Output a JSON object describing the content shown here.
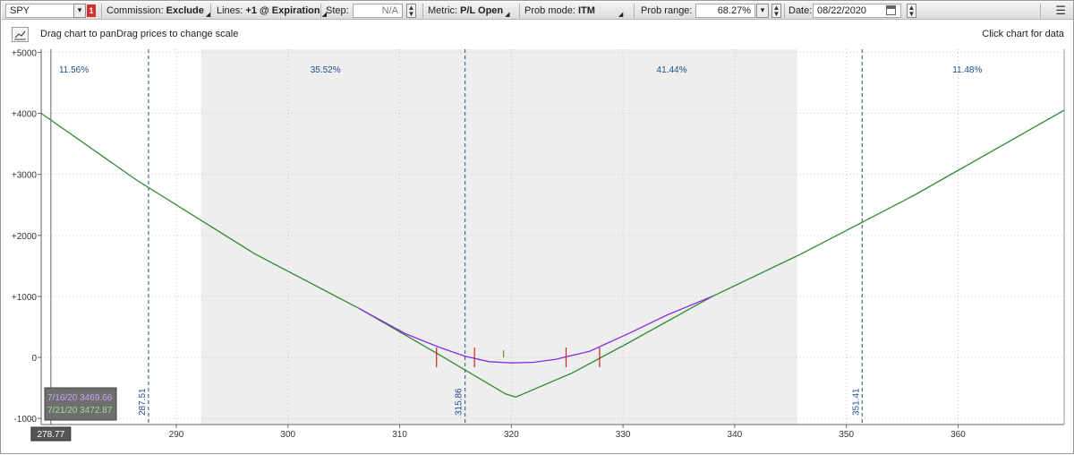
{
  "toolbar": {
    "symbol": "SPY",
    "badge": "1",
    "commission_label": "Commission:",
    "commission_value": "Exclude",
    "lines_label": "Lines:",
    "lines_value": "+1 @ Expiration",
    "step_label": "Step:",
    "step_value": "N/A",
    "metric_label": "Metric:",
    "metric_value": "P/L Open",
    "probmode_label": "Prob mode:",
    "probmode_value": "ITM",
    "probrange_label": "Prob range:",
    "probrange_value": "68.27%",
    "date_label": "Date:",
    "date_value": "08/22/2020"
  },
  "info": {
    "drag_text": "Drag chart to panDrag prices to change scale",
    "click_text": "Click chart for data"
  },
  "cursor_price": "278.77",
  "legend": [
    {
      "text": "7/16/20  3469.66",
      "color": "#8a2be2"
    },
    {
      "text": "7/21/20  3472.87",
      "color": "#2e8b2e"
    }
  ],
  "chart_data": {
    "type": "line",
    "x_ticks": [
      290,
      300,
      310,
      320,
      330,
      340,
      350,
      360
    ],
    "y_ticks": [
      {
        "value": 5000,
        "label": "+5000"
      },
      {
        "value": 4000,
        "label": "+4000"
      },
      {
        "value": 3000,
        "label": "+3000"
      },
      {
        "value": 2000,
        "label": "+2000"
      },
      {
        "value": 1000,
        "label": "+1000"
      },
      {
        "value": 0,
        "label": "0"
      },
      {
        "value": -1000,
        "label": "-1000"
      }
    ],
    "xlim": [
      277.9,
      369.5
    ],
    "ylim": [
      -1100,
      5050
    ],
    "prob_shade": [
      292.2,
      345.6
    ],
    "prob_lines": [
      {
        "x": 287.51,
        "label": "287.51"
      },
      {
        "x": 315.86,
        "label": "315.86"
      },
      {
        "x": 351.41,
        "label": "351.41"
      }
    ],
    "prob_labels": [
      {
        "x": 279.5,
        "text": "11.56%"
      },
      {
        "x": 302.0,
        "text": "35.52%"
      },
      {
        "x": 333.0,
        "text": "41.44%"
      },
      {
        "x": 359.5,
        "text": "11.48%"
      }
    ],
    "cursor_x": 278.77,
    "series": [
      {
        "name": "7/21/20",
        "color": "#2e8b2e",
        "x": [
          277.9,
          286.5,
          297.0,
          306.4,
          313.5,
          319.5,
          320.4,
          325.5,
          330.6,
          338.0,
          346.0,
          356.0,
          369.5
        ],
        "y": [
          4000,
          2900,
          1700,
          800,
          50,
          -600,
          -650,
          -250,
          250,
          1000,
          1700,
          2650,
          4050
        ]
      },
      {
        "name": "7/16/20",
        "color": "#8a2be2",
        "x": [
          306.4,
          310.5,
          313.5,
          315.86,
          318.0,
          320.0,
          322.0,
          324.0,
          327.0,
          330.6,
          334.0,
          338.0
        ],
        "y": [
          800,
          390,
          170,
          20,
          -70,
          -90,
          -80,
          -30,
          100,
          400,
          700,
          1000
        ]
      }
    ],
    "markers": [
      313.3,
      316.7,
      324.9,
      327.9
    ],
    "center_tick": 319.3
  }
}
